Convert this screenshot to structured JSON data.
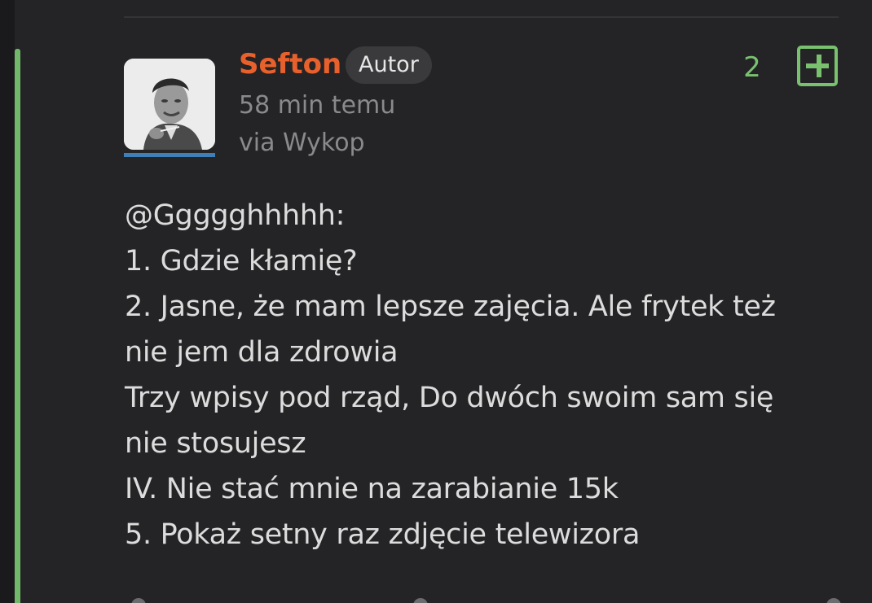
{
  "comment": {
    "author": {
      "username": "Sefton",
      "badge": "Autor"
    },
    "time": "58 min temu",
    "source": "via Wykop",
    "votes": "2",
    "mention": "@Ggggghhhhh:",
    "lines": [
      "1. Gdzie kłamię?",
      "2. Jasne, że mam lepsze zajęcia. Ale frytek też",
      "nie jem dla zdrowia",
      "Trzy wpisy pod rząd, Do dwóch swoim sam się",
      "nie stosujesz",
      "IV. Nie stać mnie na zarabianie 15k",
      "5. Pokaż setny raz zdjęcie telewizora"
    ]
  },
  "colors": {
    "username": "#e8612c",
    "vote": "#79c06f",
    "thread_line": "#72b86a",
    "background": "#242426",
    "text": "#dcdcdc"
  },
  "icons": {
    "vote": "plus-icon"
  }
}
